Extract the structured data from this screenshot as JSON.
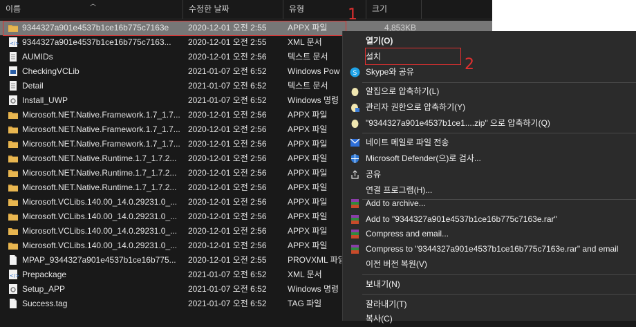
{
  "headers": {
    "name": "이름",
    "date": "수정한 날짜",
    "type": "유형",
    "size": "크기"
  },
  "files": [
    {
      "name": "9344327a901e4537b1ce16b775c7163e",
      "date": "2020-12-01 오전 2:55",
      "type": "APPX 파일",
      "size": "4,853KB",
      "icon": "folder-package-icon",
      "selected": true
    },
    {
      "name": "9344327a901e4537b1ce16b775c7163...",
      "date": "2020-12-01 오전 2:55",
      "type": "XML 문서",
      "size": "",
      "icon": "xml-file-icon"
    },
    {
      "name": "AUMIDs",
      "date": "2020-12-01 오전 2:56",
      "type": "텍스트 문서",
      "size": "",
      "icon": "text-file-icon"
    },
    {
      "name": "CheckingVCLib",
      "date": "2021-01-07 오전 6:52",
      "type": "Windows Pow",
      "size": "",
      "icon": "powershell-file-icon"
    },
    {
      "name": "Detail",
      "date": "2021-01-07 오전 6:52",
      "type": "텍스트 문서",
      "size": "",
      "icon": "text-file-icon"
    },
    {
      "name": "Install_UWP",
      "date": "2021-01-07 오전 6:52",
      "type": "Windows 명령",
      "size": "",
      "icon": "batch-file-icon"
    },
    {
      "name": "Microsoft.NET.Native.Framework.1.7_1.7...",
      "date": "2020-12-01 오전 2:56",
      "type": "APPX 파일",
      "size": "",
      "icon": "folder-package-icon"
    },
    {
      "name": "Microsoft.NET.Native.Framework.1.7_1.7...",
      "date": "2020-12-01 오전 2:56",
      "type": "APPX 파일",
      "size": "",
      "icon": "folder-package-icon"
    },
    {
      "name": "Microsoft.NET.Native.Framework.1.7_1.7...",
      "date": "2020-12-01 오전 2:56",
      "type": "APPX 파일",
      "size": "",
      "icon": "folder-package-icon"
    },
    {
      "name": "Microsoft.NET.Native.Runtime.1.7_1.7.2...",
      "date": "2020-12-01 오전 2:56",
      "type": "APPX 파일",
      "size": "",
      "icon": "folder-package-icon"
    },
    {
      "name": "Microsoft.NET.Native.Runtime.1.7_1.7.2...",
      "date": "2020-12-01 오전 2:56",
      "type": "APPX 파일",
      "size": "",
      "icon": "folder-package-icon"
    },
    {
      "name": "Microsoft.NET.Native.Runtime.1.7_1.7.2...",
      "date": "2020-12-01 오전 2:56",
      "type": "APPX 파일",
      "size": "",
      "icon": "folder-package-icon"
    },
    {
      "name": "Microsoft.VCLibs.140.00_14.0.29231.0_...",
      "date": "2020-12-01 오전 2:56",
      "type": "APPX 파일",
      "size": "",
      "icon": "folder-package-icon"
    },
    {
      "name": "Microsoft.VCLibs.140.00_14.0.29231.0_...",
      "date": "2020-12-01 오전 2:56",
      "type": "APPX 파일",
      "size": "",
      "icon": "folder-package-icon"
    },
    {
      "name": "Microsoft.VCLibs.140.00_14.0.29231.0_...",
      "date": "2020-12-01 오전 2:56",
      "type": "APPX 파일",
      "size": "",
      "icon": "folder-package-icon"
    },
    {
      "name": "Microsoft.VCLibs.140.00_14.0.29231.0_...",
      "date": "2020-12-01 오전 2:56",
      "type": "APPX 파일",
      "size": "",
      "icon": "folder-package-icon"
    },
    {
      "name": "MPAP_9344327a901e4537b1ce16b775...",
      "date": "2020-12-01 오전 2:55",
      "type": "PROVXML 파일",
      "size": "",
      "icon": "generic-file-icon"
    },
    {
      "name": "Prepackage",
      "date": "2021-01-07 오전 6:52",
      "type": "XML 문서",
      "size": "",
      "icon": "xml-file-icon"
    },
    {
      "name": "Setup_APP",
      "date": "2021-01-07 오전 6:52",
      "type": "Windows 명령",
      "size": "",
      "icon": "batch-file-icon"
    },
    {
      "name": "Success.tag",
      "date": "2021-01-07 오전 6:52",
      "type": "TAG 파일",
      "size": "",
      "icon": "generic-file-icon"
    }
  ],
  "annotations": {
    "one": "1",
    "two": "2"
  },
  "menu": {
    "open": "열기(O)",
    "install": "설치",
    "skype_share": "Skype와 공유",
    "compress_alzip": "알집으로 압축하기(L)",
    "compress_admin": "관리자 권한으로 압축하기(Y)",
    "compress_named": "\"9344327a901e4537b1ce1....zip\" 으로 압축하기(Q)",
    "mail_send": "네이트 메일로 파일 전송",
    "defender": "Microsoft Defender(으)로 검사...",
    "share": "공유",
    "open_with": "연결 프로그램(H)...",
    "add_archive": "Add to archive...",
    "add_rar": "Add to \"9344327a901e4537b1ce16b775c7163e.rar\"",
    "compress_email": "Compress and email...",
    "compress_rar_email": "Compress to \"9344327a901e4537b1ce16b775c7163e.rar\" and email",
    "restore": "이전 버전 복원(V)",
    "send_to": "보내기(N)",
    "cut": "잘라내기(T)",
    "copy": "복사(C)"
  },
  "colors": {
    "accent_red": "#e03030",
    "selected_row": "#777777",
    "menu_bg": "#2b2b2b"
  }
}
